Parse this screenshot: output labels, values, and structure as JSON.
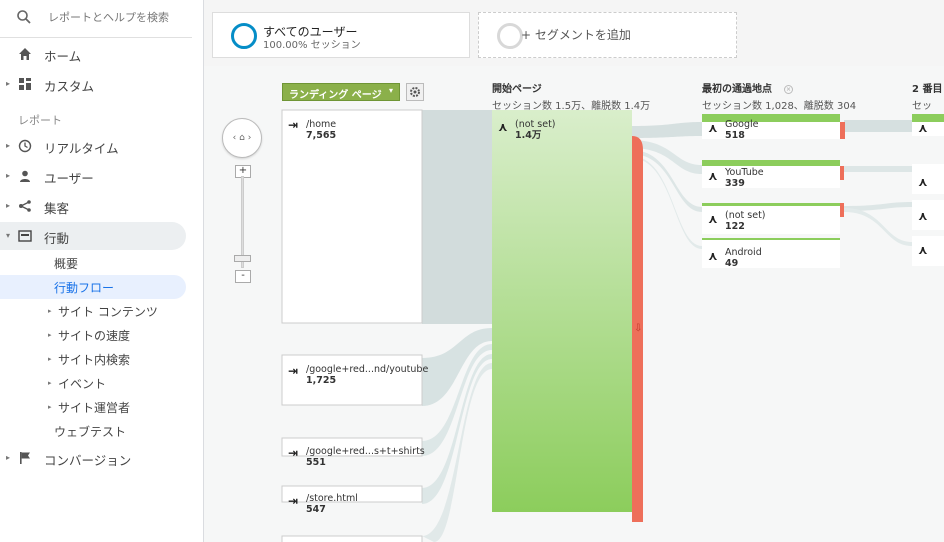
{
  "search": {
    "placeholder": "レポートとヘルプを検索",
    "icon": "search-icon"
  },
  "nav": {
    "home": "ホーム",
    "custom": "カスタム",
    "reports_heading": "レポート",
    "realtime": "リアルタイム",
    "users": "ユーザー",
    "acquisition": "集客",
    "behavior": "行動",
    "behavior_sub": {
      "overview": "概要",
      "behavior_flow": "行動フロー",
      "site_content": "サイト コンテンツ",
      "site_speed": "サイトの速度",
      "site_search": "サイト内検索",
      "events": "イベント",
      "publisher": "サイト運営者",
      "experiments": "ウェブテスト"
    },
    "conversions": "コンバージョン"
  },
  "segments": {
    "all_users": {
      "title": "すべてのユーザー",
      "subtitle": "100.00% セッション"
    },
    "add": {
      "title": "+ セグメントを追加"
    }
  },
  "flow": {
    "dimension_button": "ランディング ページ",
    "columns": {
      "start": {
        "title": "開始ページ",
        "stats": "セッション数 1.5万、離脱数 1.4万"
      },
      "first": {
        "title": "最初の通過地点",
        "stats": "セッション数 1,028、離脱数 304"
      },
      "second": {
        "title": "2 番目",
        "stats": "セッ"
      }
    },
    "landing_nodes": [
      {
        "label": "/home",
        "value": "7,565"
      },
      {
        "label": "/google+red...nd/youtube",
        "value": "1,725"
      },
      {
        "label": "/google+red...s+t+shirts",
        "value": "551"
      },
      {
        "label": "/store.html",
        "value": "547"
      }
    ],
    "start_node": {
      "label": "(not set)",
      "value": "1.4万"
    },
    "first_nodes": [
      {
        "label": "Google",
        "value": "518"
      },
      {
        "label": "YouTube",
        "value": "339"
      },
      {
        "label": "(not set)",
        "value": "122"
      },
      {
        "label": "Android",
        "value": "49"
      }
    ],
    "colors": {
      "node_green": "#8ccd5c",
      "dropoff": "#ee6f5a",
      "link": "#d3dcdc",
      "dimension": "#8bb04a"
    }
  }
}
